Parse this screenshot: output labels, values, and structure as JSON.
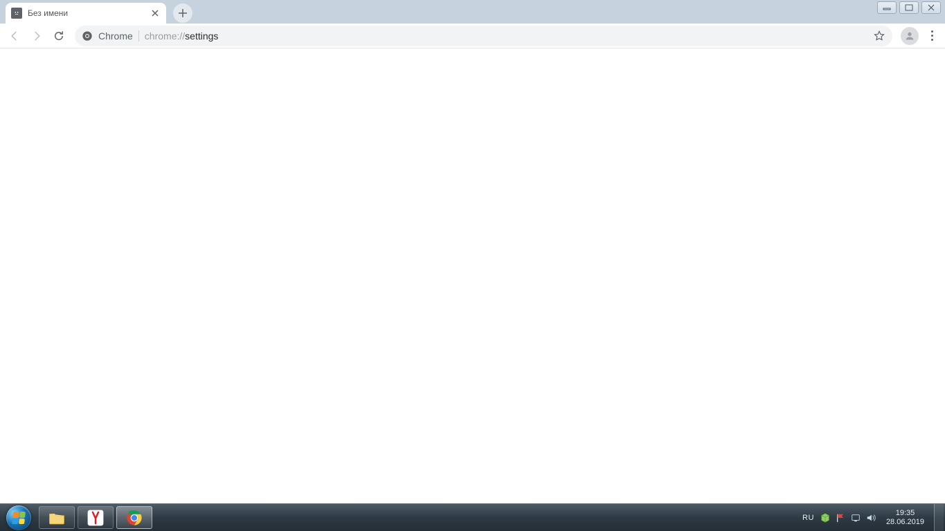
{
  "tab": {
    "title": "Без имени",
    "favicon": "sad-face-icon"
  },
  "omnibox": {
    "chip_label": "Chrome",
    "url_prefix": "chrome://",
    "url_path": "settings"
  },
  "window_controls": {
    "minimize": "minimize",
    "maximize": "maximize",
    "close": "close"
  },
  "taskbar": {
    "apps": [
      {
        "name": "start",
        "icon": "windows-logo-icon"
      },
      {
        "name": "explorer",
        "icon": "folder-icon"
      },
      {
        "name": "yandex",
        "icon": "yandex-icon"
      },
      {
        "name": "chrome",
        "icon": "chrome-icon",
        "active": true
      }
    ],
    "lang": "RU",
    "tray_icons": [
      "cube-icon",
      "flag-icon",
      "network-icon",
      "volume-icon"
    ],
    "time": "19:35",
    "date": "28.06.2019"
  }
}
